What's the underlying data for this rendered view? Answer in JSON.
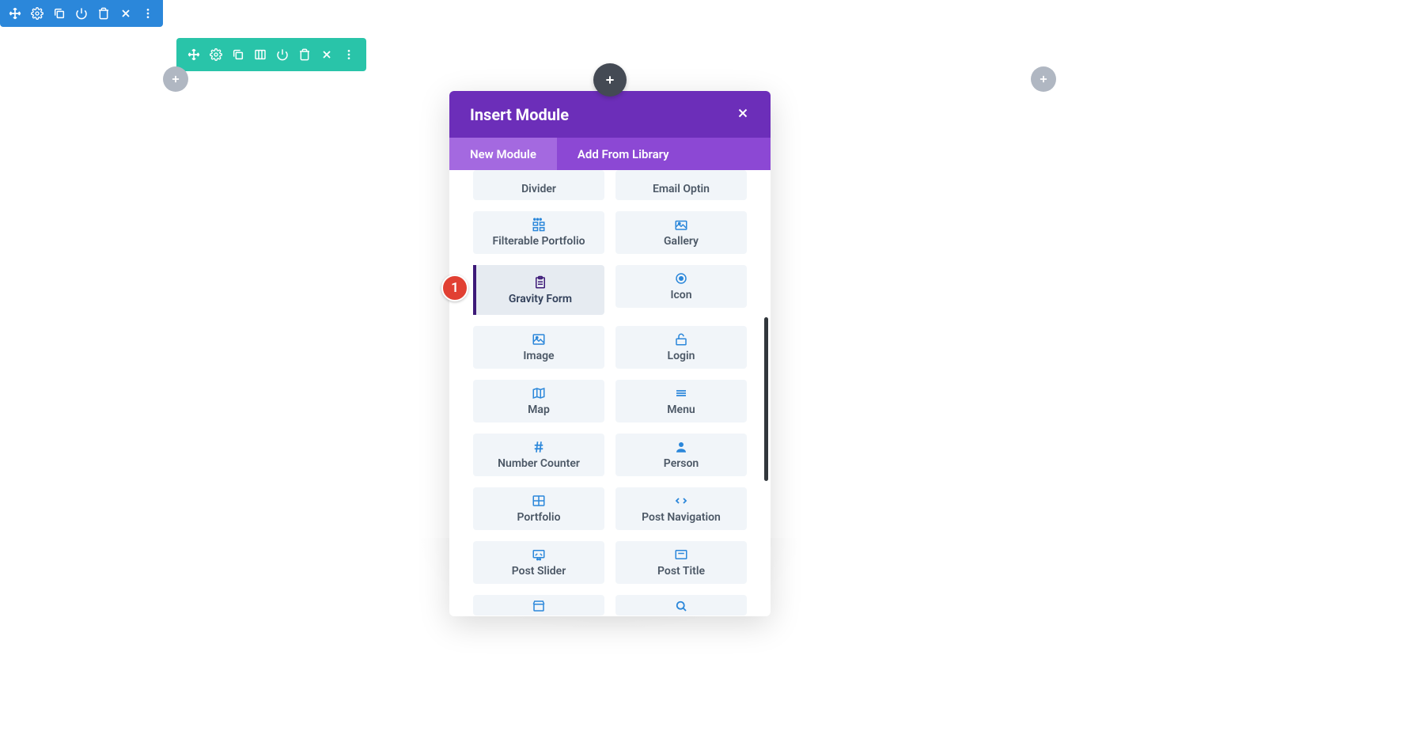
{
  "marker": "1",
  "modal": {
    "title": "Insert Module",
    "tabs": {
      "new": "New Module",
      "library": "Add From Library"
    }
  },
  "modules": {
    "divider": "Divider",
    "email_optin": "Email Optin",
    "filterable_portfolio": "Filterable Portfolio",
    "gallery": "Gallery",
    "gravity_form": "Gravity Form",
    "icon": "Icon",
    "image": "Image",
    "login": "Login",
    "map": "Map",
    "menu": "Menu",
    "number_counter": "Number Counter",
    "person": "Person",
    "portfolio": "Portfolio",
    "post_navigation": "Post Navigation",
    "post_slider": "Post Slider",
    "post_title": "Post Title"
  }
}
